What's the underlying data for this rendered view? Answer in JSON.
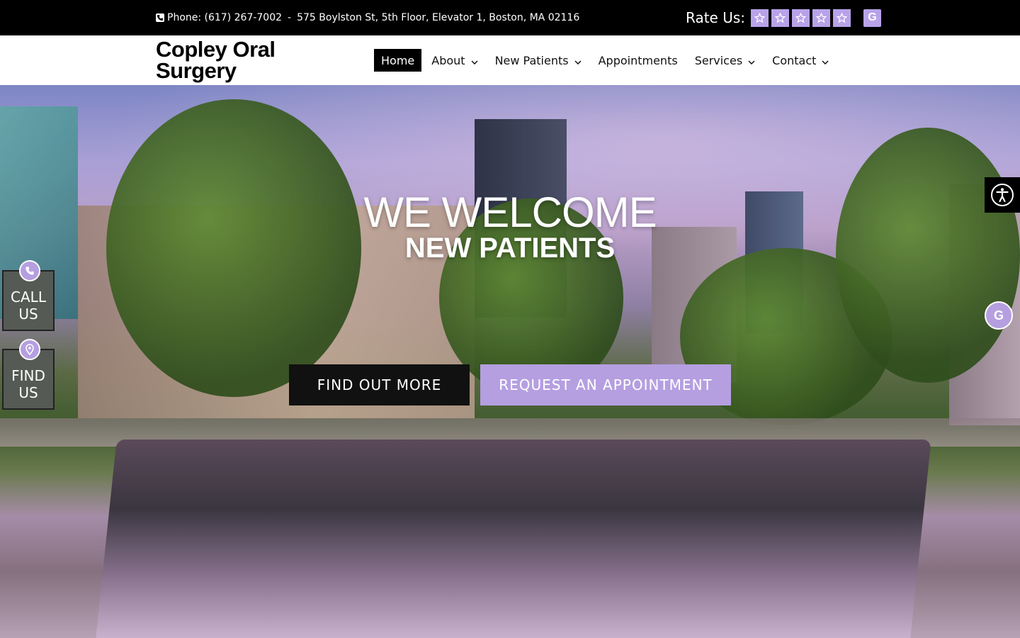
{
  "topbar": {
    "phone": "Phone: (617) 267-7002",
    "separator": "-",
    "address": "575 Boylston St, 5th Floor, Elevator 1, Boston, MA 02116",
    "rate_label": "Rate Us:",
    "stars": 5,
    "google_letter": "G"
  },
  "header": {
    "logo_line1": "Copley Oral",
    "logo_line2": "Surgery",
    "nav": [
      {
        "label": "Home",
        "active": true,
        "dropdown": false
      },
      {
        "label": "About",
        "active": false,
        "dropdown": true
      },
      {
        "label": "New Patients",
        "active": false,
        "dropdown": true
      },
      {
        "label": "Appointments",
        "active": false,
        "dropdown": false
      },
      {
        "label": "Services",
        "active": false,
        "dropdown": true
      },
      {
        "label": "Contact",
        "active": false,
        "dropdown": true
      }
    ]
  },
  "hero": {
    "title": "WE WELCOME",
    "subtitle": "NEW PATIENTS",
    "btn_find": "FIND OUT MORE",
    "btn_request": "REQUEST AN APPOINTMENT"
  },
  "side": {
    "call_line1": "CALL",
    "call_line2": "US",
    "find_line1": "FIND",
    "find_line2": "US",
    "google_letter": "G"
  },
  "colors": {
    "accent": "#b59fe0",
    "dark": "#000000"
  }
}
